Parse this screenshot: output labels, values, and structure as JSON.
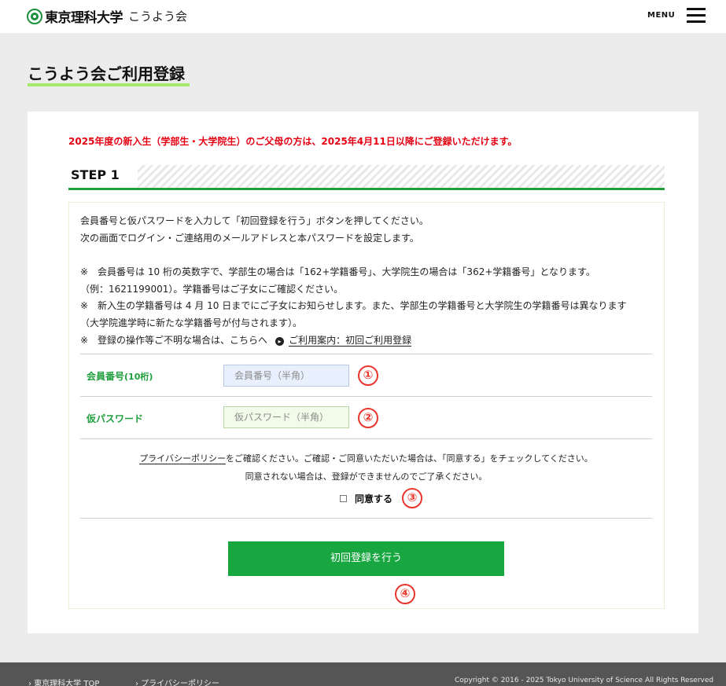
{
  "header": {
    "logo_univ": "東京理科大学",
    "logo_sub": "こうよう会",
    "menu_label": "MENU"
  },
  "page": {
    "title": "こうよう会ご利用登録"
  },
  "notice": "2025年度の新入生（学部生・大学院生）のご父母の方は、2025年4月11日以降にご登録いただけます。",
  "step": {
    "label": "STEP 1",
    "intro": [
      "会員番号と仮パスワードを入力して「初回登録を行う」ボタンを押してください。",
      "次の画面でログイン・ご連絡用のメールアドレスと本パスワードを設定します。"
    ],
    "notes": [
      "※　会員番号は 10 桁の英数字で、学部生の場合は「162+学籍番号」、大学院生の場合は「362+学籍番号」となります。",
      "（例：1621199001）。学籍番号はご子女にご確認ください。",
      "※　新入生の学籍番号は 4 月 10 日までにご子女にお知らせします。また、学部生の学籍番号と大学院生の学籍番号は異なります",
      "（大学院進学時に新たな学籍番号が付与されます）。"
    ],
    "help_prefix": "※　登録の操作等ご不明な場合は、こちらへ",
    "help_link": "ご利用案内：初回ご利用登録"
  },
  "form": {
    "member_label": "会員番号",
    "member_label_suffix": "(10桁)",
    "member_placeholder": "会員番号（半角）",
    "password_label": "仮パスワード",
    "password_placeholder": "仮パスワード（半角）",
    "policy_link": "プライバシーポリシー",
    "policy_text": "をご確認ください。ご確認・ご同意いただいた場合は、「同意する」をチェックしてください。",
    "policy_text2": "同意されない場合は、登録ができませんのでご了承ください。",
    "agree_label": "同意する",
    "submit_label": "初回登録を行う"
  },
  "badges": [
    "①",
    "②",
    "③",
    "④"
  ],
  "footer": {
    "links": [
      "› 東京理科大学 TOP",
      "› プライバシーポリシー"
    ],
    "copyright": "Copyright © 2016 - 2025 Tokyo University of Science All Rights Reserved"
  },
  "colors": {
    "accent_green": "#17a640",
    "notice_red": "#e60012",
    "badge_red": "#e8362c",
    "title_underline": "#a5e86c"
  }
}
